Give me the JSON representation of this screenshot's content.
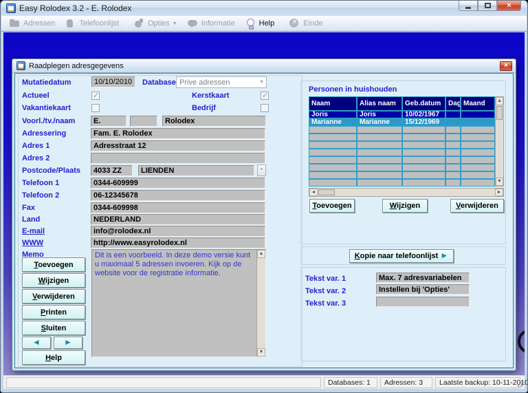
{
  "window": {
    "title": "Easy Rolodex 3.2 - E. Rolodex",
    "statusbar": {
      "panels": [
        "",
        "Databases: 1",
        "Adressen: 3",
        "Laatste backup: 10-11-2010"
      ]
    }
  },
  "toolbar": {
    "items": [
      {
        "label": "Adressen",
        "enabled": false
      },
      {
        "label": "Telefoonlijst",
        "enabled": false
      },
      {
        "label": "Opties",
        "enabled": false,
        "dropdown": true
      },
      {
        "label": "Informatie",
        "enabled": false
      },
      {
        "label": "Help",
        "enabled": true
      },
      {
        "label": "Einde",
        "enabled": false
      }
    ]
  },
  "dialog": {
    "title": "Raadplegen adresgegevens",
    "form": {
      "mutatiedatum": {
        "label": "Mutatiedatum",
        "value": "10/10/2010"
      },
      "database": {
        "label": "Database",
        "value": "Prive adressen"
      },
      "actueel": {
        "label": "Actueel",
        "checked": true
      },
      "kerstkaart": {
        "label": "Kerstkaart",
        "checked": true
      },
      "vakantiekaart": {
        "label": "Vakantiekaart",
        "checked": false
      },
      "bedrijf": {
        "label": "Bedrijf",
        "checked": false
      },
      "naam": {
        "label": "Voorl./tv./naam",
        "voorletters": "E.",
        "tussenvoegsel": "",
        "achternaam": "Rolodex"
      },
      "adressering": {
        "label": "Adressering",
        "value": "Fam. E. Rolodex"
      },
      "adres1": {
        "label": "Adres 1",
        "value": "Adresstraat 12"
      },
      "adres2": {
        "label": "Adres 2",
        "value": ""
      },
      "postcode": {
        "label": "Postcode/Plaats",
        "postcode": "4033 ZZ",
        "plaats": "LIENDEN"
      },
      "telefoon1": {
        "label": "Telefoon 1",
        "value": "0344-609999"
      },
      "telefoon2": {
        "label": "Telefoon 2",
        "value": "06-12345678"
      },
      "fax": {
        "label": "Fax",
        "value": "0344-609998"
      },
      "land": {
        "label": "Land",
        "value": "NEDERLAND"
      },
      "email": {
        "label": "E-mail",
        "value": "info@rolodex.nl"
      },
      "www": {
        "label": "WWW",
        "value": "http://www.easyrolodex.nl"
      },
      "memo": {
        "label": "Memo",
        "value": "Dit is een voorbeeld. In deze demo versie kunt u maximaal 5 adressen invoeren. Kijk op de website voor de registratie informatie."
      }
    },
    "nav_buttons": {
      "toevoegen": "Toevoegen",
      "wijzigen": "Wijzigen",
      "verwijderen": "Verwijderen",
      "printen": "Printen",
      "sluiten": "Sluiten",
      "help": "Help"
    },
    "household": {
      "heading": "Personen in huishouden",
      "headers": [
        "Naam",
        "Alias naam",
        "Geb.datum",
        "Dag",
        "Maand"
      ],
      "rows": [
        [
          "Joris",
          "Joris",
          "10/02/1967",
          "",
          ""
        ],
        [
          "Marianne",
          "Marianne",
          "15/12/1969",
          "",
          ""
        ]
      ],
      "buttons": {
        "toevoegen": "Toevoegen",
        "wijzigen": "Wijzigen",
        "verwijderen": "Verwijderen"
      }
    },
    "kopie": {
      "label": "Kopie naar telefoonlijst"
    },
    "tekstvars": {
      "items": [
        {
          "label": "Tekst var. 1",
          "value": "Max. 7 adresvariabelen"
        },
        {
          "label": "Tekst var. 2",
          "value": "Instellen bij 'Opties'"
        },
        {
          "label": "Tekst var. 3",
          "value": ""
        }
      ]
    }
  },
  "colors": {
    "client_top": "#0b04c6",
    "client_bottom": "#8d89c9",
    "label_blue": "#2222cc",
    "field_gray": "#c0c0c0",
    "button_cyan": "#d2f2f3",
    "table_header": "#00007e",
    "row_selected": "#0000a8",
    "row_alt": "#2e96c8",
    "table_border": "#2f9fc8",
    "memo_text": "#3434cc",
    "close_red": "#bf3c24"
  }
}
